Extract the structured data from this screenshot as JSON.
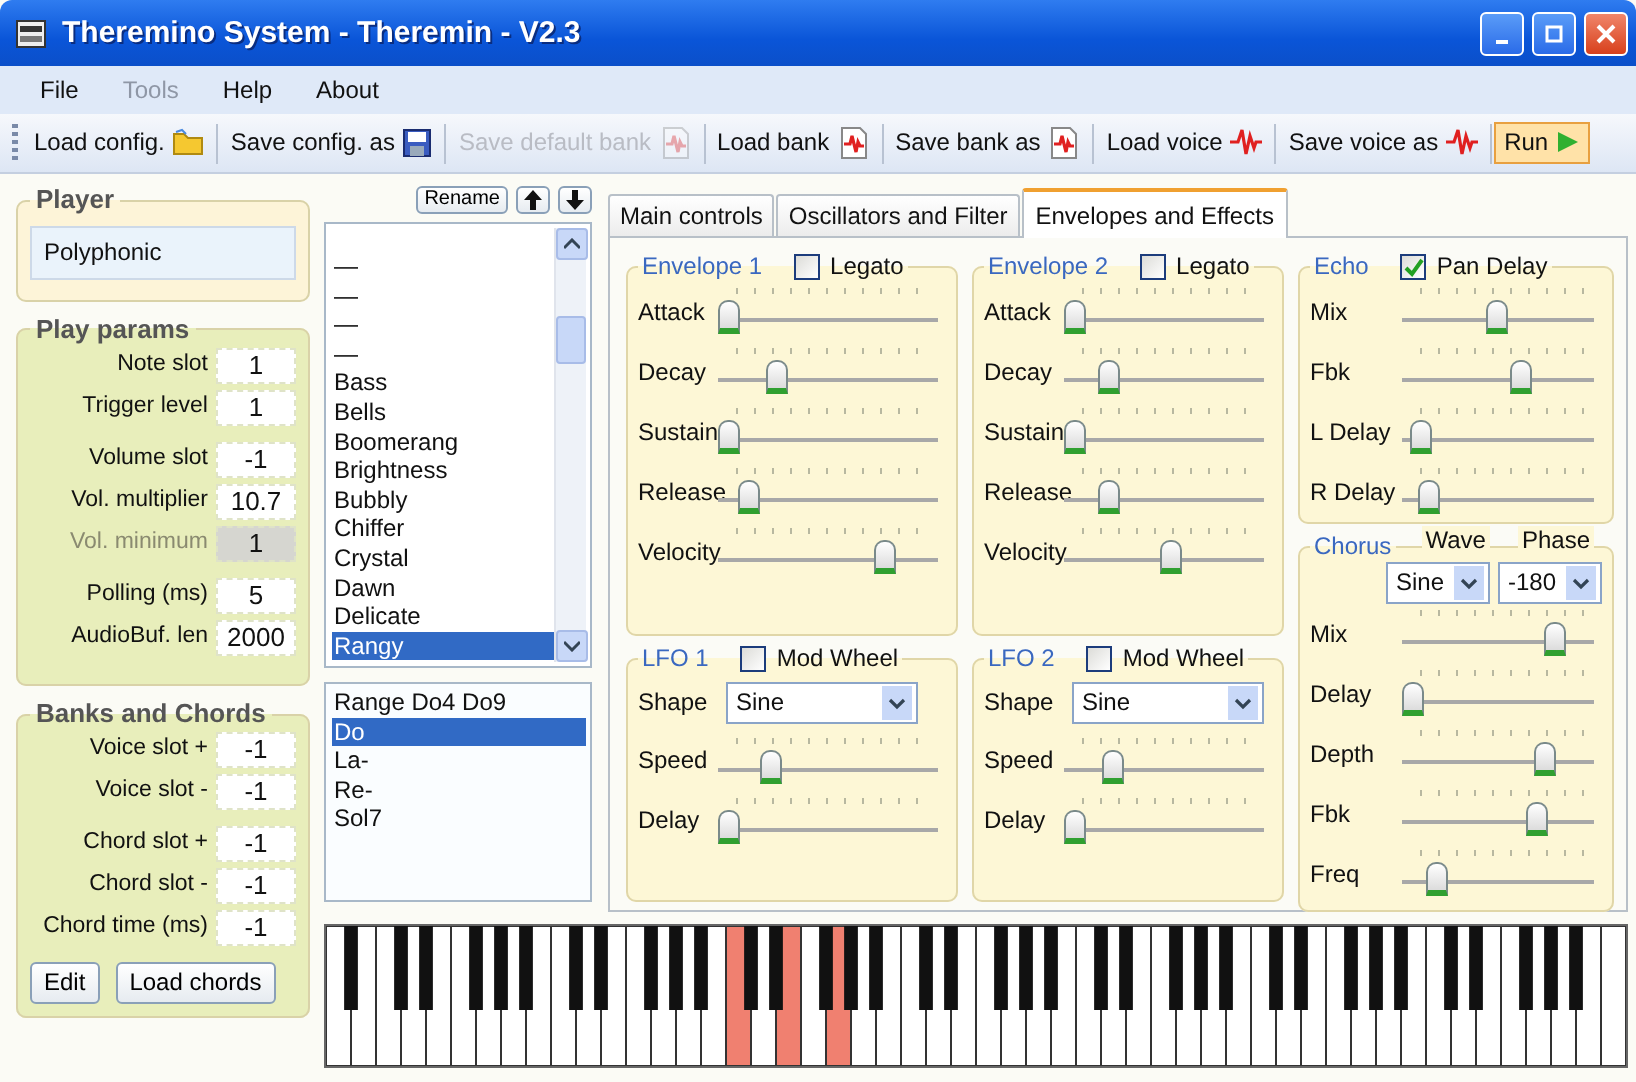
{
  "window": {
    "title": "Theremino System - Theremin - V2.3"
  },
  "menu": [
    {
      "label": "File",
      "disabled": false
    },
    {
      "label": "Tools",
      "disabled": true
    },
    {
      "label": "Help",
      "disabled": false
    },
    {
      "label": "About",
      "disabled": false
    }
  ],
  "toolbar": [
    {
      "label": "Load config.",
      "kind": "folder",
      "disabled": false,
      "pressed": false
    },
    {
      "label": "Save config. as",
      "kind": "floppy",
      "disabled": false,
      "pressed": false
    },
    {
      "label": "Save default bank",
      "kind": "bank",
      "disabled": true,
      "pressed": false
    },
    {
      "label": "Load bank",
      "kind": "bank",
      "disabled": false,
      "pressed": false
    },
    {
      "label": "Save bank as",
      "kind": "bank",
      "disabled": false,
      "pressed": false
    },
    {
      "label": "Load voice",
      "kind": "wave",
      "disabled": false,
      "pressed": false
    },
    {
      "label": "Save voice as",
      "kind": "wave",
      "disabled": false,
      "pressed": false
    },
    {
      "label": "Run",
      "kind": "play",
      "disabled": false,
      "pressed": true
    }
  ],
  "player": {
    "title": "Player",
    "mode": "Polyphonic"
  },
  "play_params": {
    "title": "Play params",
    "field_groups": [
      [
        {
          "label": "Note slot",
          "value": "1",
          "disabled": false
        },
        {
          "label": "Trigger level",
          "value": "1",
          "disabled": false
        }
      ],
      [
        {
          "label": "Volume slot",
          "value": "-1",
          "disabled": false
        },
        {
          "label": "Vol. multiplier",
          "value": "10.7",
          "disabled": false
        },
        {
          "label": "Vol. minimum",
          "value": "1",
          "disabled": true
        }
      ],
      [
        {
          "label": "Polling (ms)",
          "value": "5",
          "disabled": false
        },
        {
          "label": "AudioBuf.  len",
          "value": "2000",
          "disabled": false
        }
      ]
    ]
  },
  "banks_and_chords": {
    "title": "Banks and Chords",
    "field_groups": [
      [
        {
          "label": "Voice slot +",
          "value": "-1",
          "disabled": false
        },
        {
          "label": "Voice slot -",
          "value": "-1",
          "disabled": false
        }
      ],
      [
        {
          "label": "Chord slot +",
          "value": "-1",
          "disabled": false
        },
        {
          "label": "Chord slot -",
          "value": "-1",
          "disabled": false
        },
        {
          "label": "Chord time (ms)",
          "value": "-1",
          "disabled": false
        }
      ]
    ],
    "buttons": [
      "Edit",
      "Load chords"
    ]
  },
  "voice_list": {
    "buttons": [
      {
        "kind": "text",
        "label": "Rename"
      },
      {
        "kind": "up"
      },
      {
        "kind": "down"
      }
    ],
    "items": [
      {
        "label": "—",
        "selected": false
      },
      {
        "label": "—",
        "selected": false
      },
      {
        "label": "—",
        "selected": false
      },
      {
        "label": "—",
        "selected": false
      },
      {
        "label": "Bass",
        "selected": false
      },
      {
        "label": "Bells",
        "selected": false
      },
      {
        "label": "Boomerang",
        "selected": false
      },
      {
        "label": "Brightness",
        "selected": false
      },
      {
        "label": "Bubbly",
        "selected": false
      },
      {
        "label": "Chiffer",
        "selected": false
      },
      {
        "label": "Crystal",
        "selected": false
      },
      {
        "label": "Dawn",
        "selected": false
      },
      {
        "label": "Delicate",
        "selected": false
      },
      {
        "label": "Rangy",
        "selected": true
      }
    ]
  },
  "chord_list": {
    "items": [
      {
        "label": "Range Do4 Do9",
        "selected": false
      },
      {
        "label": "Do",
        "selected": true
      },
      {
        "label": "La-",
        "selected": false
      },
      {
        "label": "Re-",
        "selected": false
      },
      {
        "label": "Sol7",
        "selected": false
      }
    ]
  },
  "tabs": [
    {
      "label": "Main controls",
      "selected": false
    },
    {
      "label": "Oscillators and Filter",
      "selected": false
    },
    {
      "label": "Envelopes and Effects",
      "selected": true
    }
  ],
  "columns": [
    [
      {
        "kind": "envelope",
        "title": "Envelope 1",
        "option": {
          "label": "Legato",
          "checked": false
        },
        "sliders": [
          {
            "label": "Attack",
            "level": 0
          },
          {
            "label": "Decay",
            "level": 0.25
          },
          {
            "label": "Sustain",
            "level": 0
          },
          {
            "label": "Release",
            "level": 0.1
          },
          {
            "label": "Velocity",
            "level": 0.8
          }
        ]
      },
      {
        "kind": "lfo",
        "title": "LFO 1",
        "option": {
          "label": "Mod Wheel",
          "checked": false
        },
        "selects": [
          {
            "label": "Shape",
            "value": "Sine"
          }
        ],
        "sliders": [
          {
            "label": "Speed",
            "level": 0.22
          },
          {
            "label": "Delay",
            "level": 0
          }
        ]
      }
    ],
    [
      {
        "kind": "envelope",
        "title": "Envelope 2",
        "option": {
          "label": "Legato",
          "checked": false
        },
        "sliders": [
          {
            "label": "Attack",
            "level": 0
          },
          {
            "label": "Decay",
            "level": 0.2
          },
          {
            "label": "Sustain",
            "level": 0
          },
          {
            "label": "Release",
            "level": 0.2
          },
          {
            "label": "Velocity",
            "level": 0.55
          }
        ]
      },
      {
        "kind": "lfo",
        "title": "LFO 2",
        "option": {
          "label": "Mod Wheel",
          "checked": false
        },
        "selects": [
          {
            "label": "Shape",
            "value": "Sine"
          }
        ],
        "sliders": [
          {
            "label": "Speed",
            "level": 0.22
          },
          {
            "label": "Delay",
            "level": 0
          }
        ]
      }
    ],
    [
      {
        "kind": "echo",
        "title": "Echo",
        "option": {
          "label": "Pan Delay",
          "checked": true
        },
        "sliders": [
          {
            "label": "Mix",
            "level": 0.5
          },
          {
            "label": "Fbk",
            "level": 0.65
          },
          {
            "label": "L Delay",
            "level": 0.05
          },
          {
            "label": "R Delay",
            "level": 0.1
          }
        ]
      },
      {
        "kind": "chorus",
        "title": "Chorus",
        "selects": [
          {
            "label": "Wave",
            "value": "Sine"
          },
          {
            "label": "Phase",
            "value": "-180"
          }
        ],
        "sliders": [
          {
            "label": "Mix",
            "level": 0.85
          },
          {
            "label": "Delay",
            "level": 0
          },
          {
            "label": "Depth",
            "level": 0.8
          },
          {
            "label": "Fbk",
            "level": 0.75
          },
          {
            "label": "Freq",
            "level": 0.15
          }
        ]
      }
    ]
  ],
  "keyboard": {
    "white_keys": [
      {
        "pressed": false
      },
      {
        "pressed": false
      },
      {
        "pressed": false
      },
      {
        "pressed": false
      },
      {
        "pressed": false
      },
      {
        "pressed": false
      },
      {
        "pressed": false
      },
      {
        "pressed": false
      },
      {
        "pressed": false
      },
      {
        "pressed": false
      },
      {
        "pressed": false
      },
      {
        "pressed": false
      },
      {
        "pressed": false
      },
      {
        "pressed": false
      },
      {
        "pressed": false
      },
      {
        "pressed": false
      },
      {
        "pressed": true
      },
      {
        "pressed": false
      },
      {
        "pressed": true
      },
      {
        "pressed": false
      },
      {
        "pressed": true
      },
      {
        "pressed": false
      },
      {
        "pressed": false
      },
      {
        "pressed": false
      },
      {
        "pressed": false
      },
      {
        "pressed": false
      },
      {
        "pressed": false
      },
      {
        "pressed": false
      },
      {
        "pressed": false
      },
      {
        "pressed": false
      },
      {
        "pressed": false
      },
      {
        "pressed": false
      },
      {
        "pressed": false
      },
      {
        "pressed": false
      },
      {
        "pressed": false
      },
      {
        "pressed": false
      },
      {
        "pressed": false
      },
      {
        "pressed": false
      },
      {
        "pressed": false
      },
      {
        "pressed": false
      },
      {
        "pressed": false
      },
      {
        "pressed": false
      },
      {
        "pressed": false
      },
      {
        "pressed": false
      },
      {
        "pressed": false
      },
      {
        "pressed": false
      },
      {
        "pressed": false
      },
      {
        "pressed": false
      },
      {
        "pressed": false
      },
      {
        "pressed": false
      },
      {
        "pressed": false
      },
      {
        "pressed": false
      }
    ],
    "black_keys": [
      {
        "pressed": false
      },
      {
        "pressed": false
      },
      {
        "pressed": false
      },
      {
        "pressed": false
      },
      {
        "pressed": false
      },
      {
        "pressed": false
      },
      {
        "pressed": false
      },
      {
        "pressed": false
      },
      {
        "pressed": false
      },
      {
        "pressed": false
      },
      {
        "pressed": false
      },
      {
        "pressed": false
      },
      {
        "pressed": false
      },
      {
        "pressed": false
      },
      {
        "pressed": false
      },
      {
        "pressed": false
      },
      {
        "pressed": false
      },
      {
        "pressed": false
      },
      {
        "pressed": false
      },
      {
        "pressed": false
      },
      {
        "pressed": false
      },
      {
        "pressed": false
      },
      {
        "pressed": false
      },
      {
        "pressed": false
      },
      {
        "pressed": false
      },
      {
        "pressed": false
      },
      {
        "pressed": false
      },
      {
        "pressed": false
      },
      {
        "pressed": false
      },
      {
        "pressed": false
      },
      {
        "pressed": false
      },
      {
        "pressed": false
      },
      {
        "pressed": false
      },
      {
        "pressed": false
      },
      {
        "pressed": false
      },
      {
        "pressed": false
      }
    ]
  }
}
